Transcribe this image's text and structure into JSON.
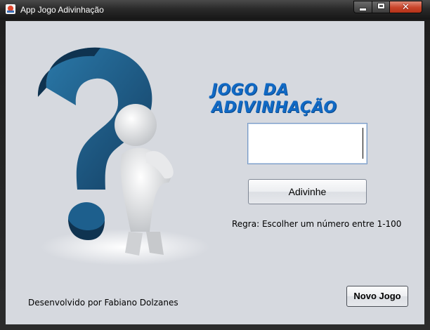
{
  "window": {
    "title": "App Jogo Adivinhação",
    "controls": {
      "minimize": "minimize-icon",
      "maximize": "maximize-icon",
      "close": "✕"
    }
  },
  "main": {
    "heading": "JOGO DA ADIVINHAÇÃO",
    "guess_input": {
      "value": "",
      "placeholder": ""
    },
    "guess_button": "Adivinhe",
    "rule": "Regra: Escolher um número entre 1-100",
    "new_game_button": "Novo Jogo",
    "credit": "Desenvolvido por Fabiano Dolzanes"
  },
  "colors": {
    "heading": "#1169c4",
    "question_mark": "#1b5a86",
    "background": "#d6d9df"
  }
}
